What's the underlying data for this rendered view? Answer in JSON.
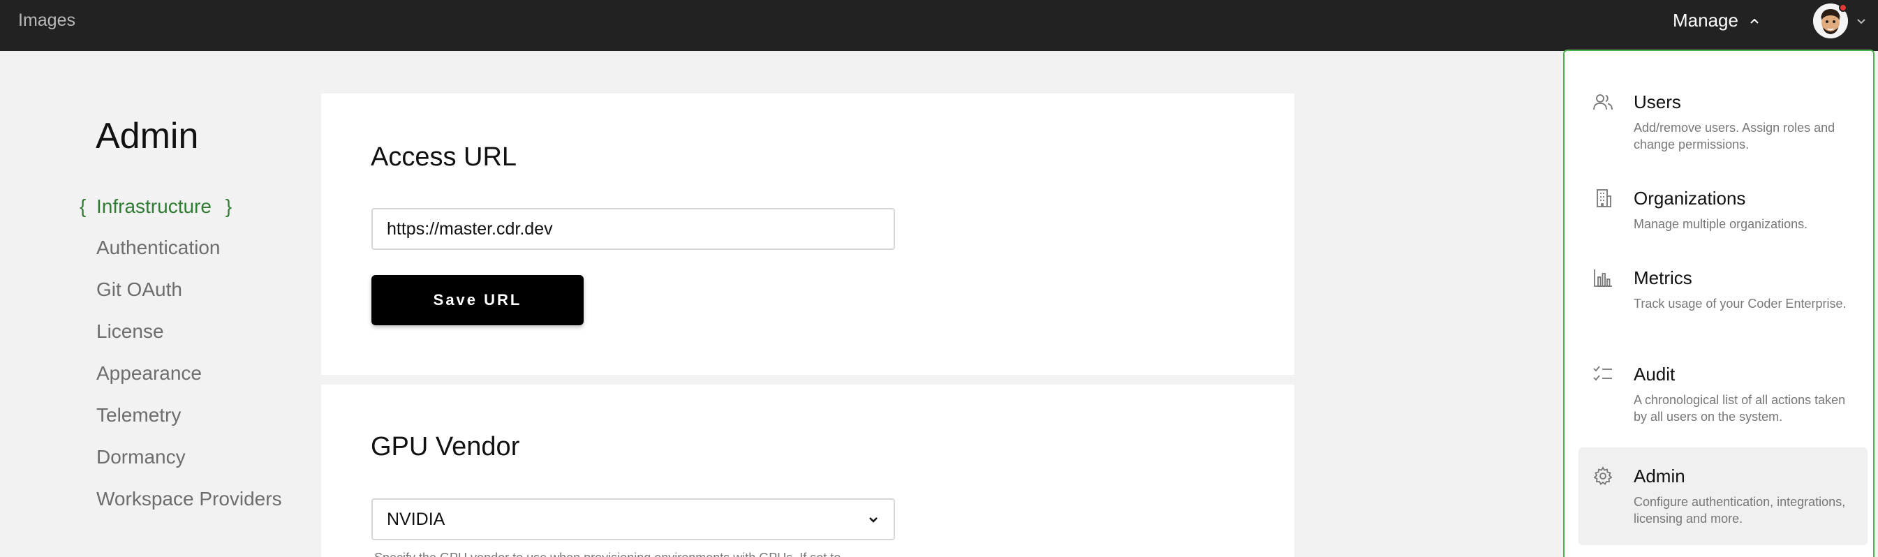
{
  "topbar": {
    "brand": "Images",
    "manage_label": "Manage"
  },
  "admin": {
    "title": "Admin"
  },
  "sidenav": {
    "items": [
      {
        "label": "Infrastructure",
        "active": true
      },
      {
        "label": "Authentication"
      },
      {
        "label": "Git OAuth"
      },
      {
        "label": "License"
      },
      {
        "label": "Appearance"
      },
      {
        "label": "Telemetry"
      },
      {
        "label": "Dormancy"
      },
      {
        "label": "Workspace Providers"
      }
    ]
  },
  "access_url": {
    "heading": "Access URL",
    "value": "https://master.cdr.dev",
    "save_label": "Save URL"
  },
  "gpu_vendor": {
    "heading": "GPU Vendor",
    "selected": "NVIDIA",
    "help": "Specify the GPU vendor to use when provisioning environments with GPUs. If set to"
  },
  "manage_menu": {
    "items": [
      {
        "icon": "users-icon",
        "title": "Users",
        "desc": "Add/remove users. Assign roles and change permissions."
      },
      {
        "icon": "building-icon",
        "title": "Organizations",
        "desc": "Manage multiple organizations."
      },
      {
        "icon": "bar-chart-icon",
        "title": "Metrics",
        "desc": "Track usage of your Coder Enterprise."
      },
      {
        "icon": "checklist-icon",
        "title": "Audit",
        "desc": "A chronological list of all actions taken by all users on the system."
      },
      {
        "icon": "gear-icon",
        "title": "Admin",
        "desc": "Configure authentication, integrations, licensing and more.",
        "selected": true
      }
    ]
  },
  "colors": {
    "topbar": "#222222",
    "accent_green": "#2e7d32",
    "menu_border": "#4caf50",
    "button": "#000000"
  }
}
